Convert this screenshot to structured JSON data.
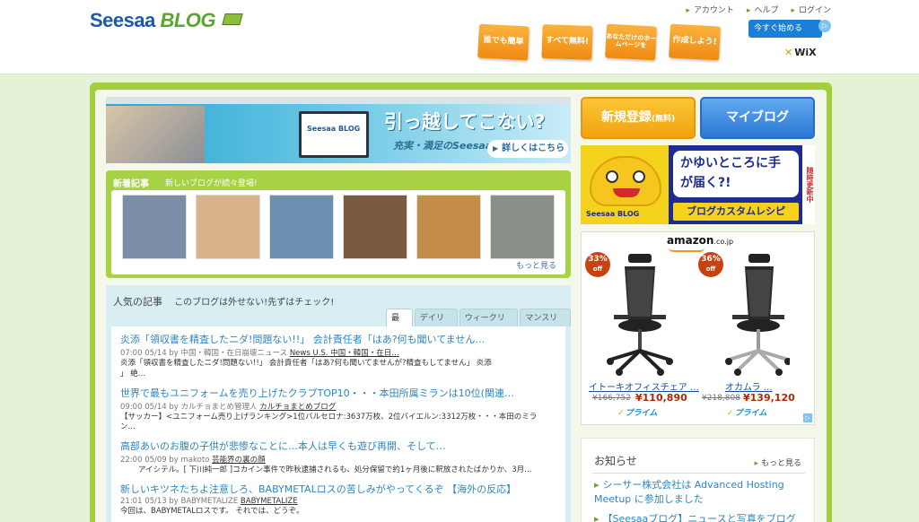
{
  "header": {
    "logo_seesaa": "Seesaa",
    "logo_blog": "BLOG",
    "links": [
      "アカウント",
      "ヘルプ",
      "ログイン"
    ],
    "promos": [
      "誰でも簡単",
      "すべて無料!",
      "あなただけのホームページを",
      "作成しよう!"
    ],
    "ad": {
      "button": "今すぐ始める",
      "info": "▷",
      "brand": "WiX"
    }
  },
  "banner": {
    "monitor_brand": "Seesaa BLOG",
    "headline": "引っ越してこない?",
    "sub": "充実・満足のSeesaaブログライフ",
    "more": "詳しくはこちら"
  },
  "new_articles": {
    "title": "新着記事",
    "tagline": "新しいブログが続々登場!",
    "more": "もっと見る",
    "thumbs": [
      {
        "name": "jeans-thumb",
        "color": "#7b8ea6"
      },
      {
        "name": "food-bowl-thumb",
        "color": "#d9b38a"
      },
      {
        "name": "fish-thumb",
        "color": "#6d8fb2"
      },
      {
        "name": "bamboo-thumb",
        "color": "#7a5a40"
      },
      {
        "name": "meal-thumb",
        "color": "#c48d4a"
      },
      {
        "name": "building-thumb",
        "color": "#8a8f8a"
      }
    ]
  },
  "popular": {
    "lead": "人気の記事",
    "tagline": "このブログは外せない!先ずはチェック!",
    "tabs": [
      "最新",
      "デイリー",
      "ウィークリー",
      "マンスリー"
    ],
    "articles": [
      {
        "title": "炎添「領収書を精査したニダ!問題ない!!」 会計責任者「はあ?何も聞いてません…",
        "meta": "07:00 05/14 by 中国・韓国・在日崩壊ニュース",
        "blog": "News U.S. 中国・韓国・在日…",
        "body": "炎添「領収書を精査したニダ!問題ない!!」 会計責任者「はあ?何も聞いてませんが?精査もしてません」 炎添",
        "body2": "」 絶…"
      },
      {
        "title": "世界で最もユニフォームを売り上げたクラブTOP10・・・本田所属ミランは10位(関連…",
        "meta": "09:00 05/14 by カルチョまとめ管理人",
        "blog": "カルチョまとめブログ",
        "body": "【サッカー】<ユニフォーム売り上げランキング>1位バルセロナ:3637万枚、2位バイエルン:3312万枚・・・本田のミラ",
        "body2": "ン…"
      },
      {
        "title": "高部あいのお腹の子供が悲惨なことに…本人は早くも遊び再開、そして…",
        "meta": "22:00 05/09 by makoto",
        "blog": "芸能界の裏の顔",
        "body": "アイシテル。[ 下川純一郎 ]コカイン事件で昨秋逮捕されるも、処分保留で約1ヶ月後に釈放されたばかりか、3月…",
        "body2": ""
      },
      {
        "title": "新しいキツネたちよ注意しろ、BABYMETALロスの苦しみがやってくるぞ 【海外の反応】",
        "meta": "21:01 05/13 by BABYMETALIZE",
        "blog": "BABYMETALIZE",
        "body": "今回は、BABYMETALロスです。 それでは、どうぞ。",
        "body2": ""
      }
    ]
  },
  "right": {
    "register": "新規登録",
    "register_small": "(無料)",
    "myblog": "マイブログ",
    "custom_banner": {
      "bubble": "かゆいところに手が届く?!",
      "recipe": "ブログカスタムレシピ",
      "brand": "Seesaa BLOG",
      "vertical": "随時更新中"
    },
    "amazon": {
      "logo": "amazon",
      "logo_suffix": ".co.jp",
      "products": [
        {
          "discount": "33%",
          "off": "off",
          "name": "イトーキオフィスチェア …",
          "old": "¥166,752",
          "new": "¥110,890",
          "prime": "プライム"
        },
        {
          "discount": "36%",
          "off": "off",
          "name": "オカムラ …",
          "old": "¥218,808",
          "new": "¥139,120",
          "prime": "プライム"
        }
      ]
    },
    "news": {
      "title": "お知らせ",
      "more": "もっと見る",
      "items": [
        "シーサー株式会社は Advanced Hosting Meetup に参加しました",
        "【Seesaaブログ】ニュースと写真をブログに引"
      ]
    }
  }
}
